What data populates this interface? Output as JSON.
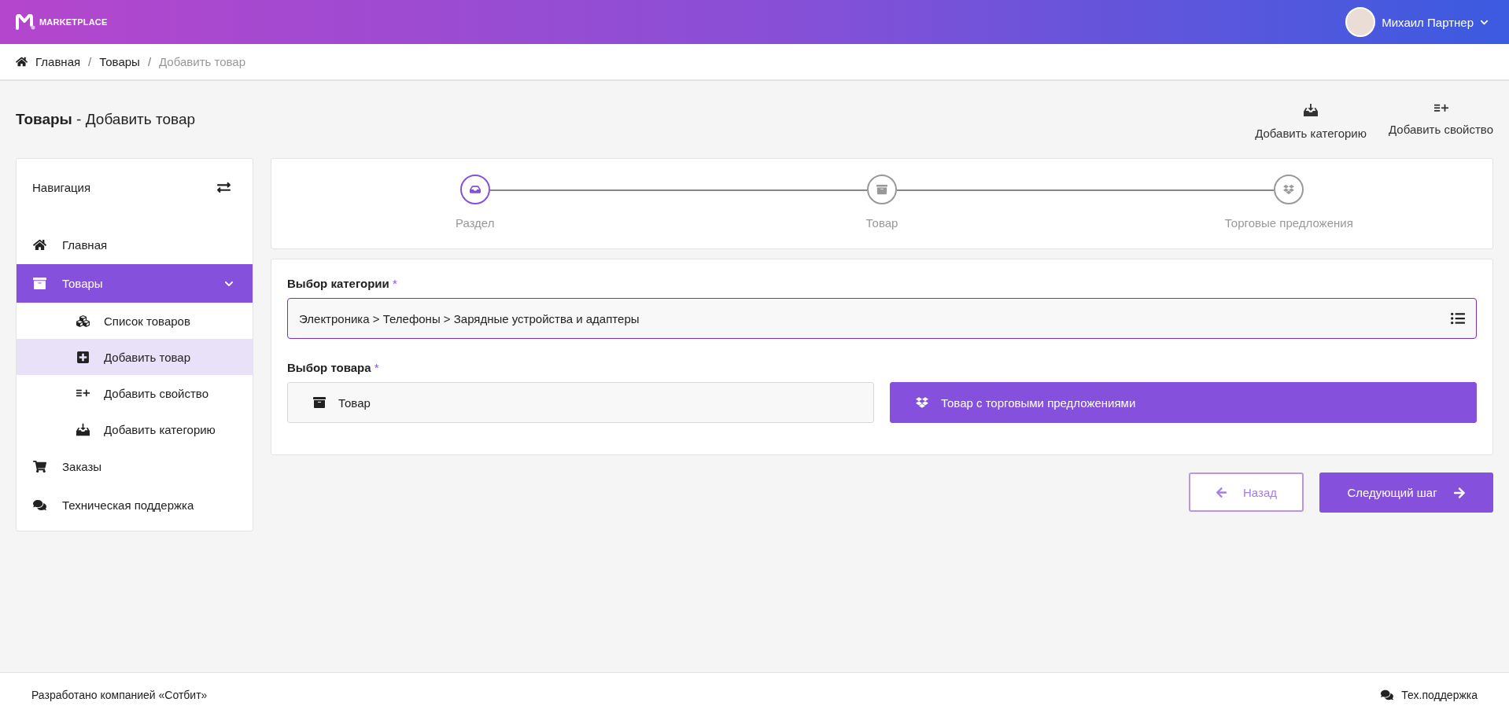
{
  "header": {
    "logo_text": "MARKETPLACE",
    "user_name": "Михаил Партнер"
  },
  "breadcrumb_separator": "/",
  "breadcrumbs": [
    {
      "label": "Главная",
      "current": false
    },
    {
      "label": "Товары",
      "current": false
    },
    {
      "label": "Добавить товар",
      "current": true
    }
  ],
  "page_title": "**Товары** - Добавить товар",
  "actions": [
    {
      "label": "Добавить категорию"
    },
    {
      "label": "Добавить свойство"
    }
  ],
  "sidebar": {
    "title": "Навигация",
    "items": [
      {
        "label": "Главная",
        "selected": false
      },
      {
        "label": "Товары",
        "selected": true,
        "expanded": true,
        "children": [
          {
            "label": "Список товаров",
            "selected": false
          },
          {
            "label": "Добавить товар",
            "selected": true
          },
          {
            "label": "Добавить свойство",
            "selected": false
          },
          {
            "label": "Добавить категорию",
            "selected": false
          }
        ]
      },
      {
        "label": "Заказы",
        "selected": false
      },
      {
        "label": "Техническая поддержка",
        "selected": false
      }
    ]
  },
  "steps": [
    {
      "label": "Раздел",
      "selected": true
    },
    {
      "label": "Товар",
      "selected": false
    },
    {
      "label": "Торговые предложения",
      "selected": false
    }
  ],
  "form": {
    "category_label": "Выбор категории",
    "category_required": "*",
    "category_value": "Электроника > Телефоны > Зарядные устройства и адаптеры",
    "product_label": "Выбор товара",
    "product_required": "*",
    "product_options": [
      {
        "label": "Товар",
        "selected": false
      },
      {
        "label": "Товар с торговыми предложениями",
        "selected": true
      }
    ]
  },
  "buttons": {
    "back": "Назад",
    "next": "Следующий шаг"
  },
  "footer": {
    "credit": "Разработано компанией «Сотбит»",
    "support": "Тех.поддержка"
  }
}
